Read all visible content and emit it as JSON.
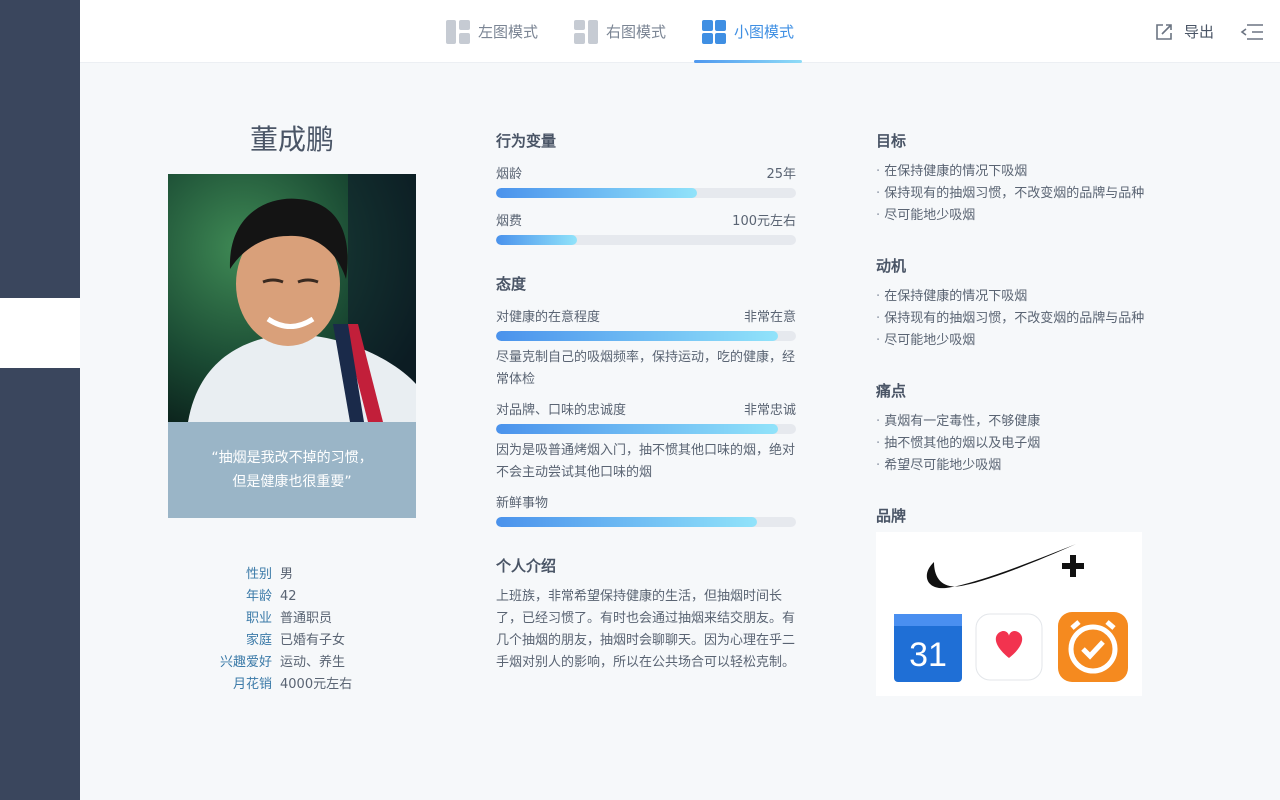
{
  "tabs": [
    {
      "label": "左图模式",
      "active": false
    },
    {
      "label": "右图模式",
      "active": false
    },
    {
      "label": "小图模式",
      "active": true
    }
  ],
  "export_label": "导出",
  "persona": {
    "name": "董成鹏",
    "quote_line1": "“抽烟是我改不掉的习惯，",
    "quote_line2": "但是健康也很重要”",
    "facts": [
      {
        "key": "性别",
        "value": "男"
      },
      {
        "key": "年龄",
        "value": "42"
      },
      {
        "key": "职业",
        "value": "普通职员"
      },
      {
        "key": "家庭",
        "value": "已婚有子女"
      },
      {
        "key": "兴趣爱好",
        "value": "运动、养生"
      },
      {
        "key": "月花销",
        "value": "4000元左右"
      }
    ]
  },
  "behavior": {
    "title": "行为变量",
    "items": [
      {
        "label": "烟龄",
        "value": "25年",
        "level": 0.67
      },
      {
        "label": "烟费",
        "value": "100元左右",
        "level": 0.27
      }
    ]
  },
  "attitude": {
    "title": "态度",
    "items": [
      {
        "label": "对健康的在意程度",
        "value": "非常在意",
        "level": 0.94,
        "desc": "尽量克制自己的吸烟频率，保持运动，吃的健康，经常体检"
      },
      {
        "label": "对品牌、口味的忠诚度",
        "value": "非常忠诚",
        "level": 0.94,
        "desc": "因为是吸普通烤烟入门，抽不惯其他口味的烟，绝对不会主动尝试其他口味的烟"
      },
      {
        "label": "新鲜事物",
        "value": "",
        "level": 0.87,
        "desc": ""
      }
    ]
  },
  "intro": {
    "title": "个人介绍",
    "text": "上班族，非常希望保持健康的生活，但抽烟时间长了，已经习惯了。有时也会通过抽烟来结交朋友。有几个抽烟的朋友，抽烟时会聊聊天。因为心理在乎二手烟对别人的影响，所以在公共场合可以轻松克制。"
  },
  "goals": {
    "title": "目标",
    "items": [
      "在保持健康的情况下吸烟",
      "保持现有的抽烟习惯，不改变烟的品牌与品种",
      "尽可能地少吸烟"
    ]
  },
  "motivation": {
    "title": "动机",
    "items": [
      "在保持健康的情况下吸烟",
      "保持现有的抽烟习惯，不改变烟的品牌与品种",
      "尽可能地少吸烟"
    ]
  },
  "pain_points": {
    "title": "痛点",
    "items": [
      "真烟有一定毒性，不够健康",
      "抽不惯其他的烟以及电子烟",
      "希望尽可能地少吸烟"
    ]
  },
  "brands": {
    "title": "品牌",
    "calendar_day": "31",
    "icons": [
      "nike-plus-logo",
      "google-calendar-icon",
      "apple-health-icon",
      "alarm-clock-icon"
    ]
  },
  "colors": {
    "accent": "#3f8fe3",
    "rail": "#3a465d",
    "quote_bg": "#9ab5c7"
  }
}
